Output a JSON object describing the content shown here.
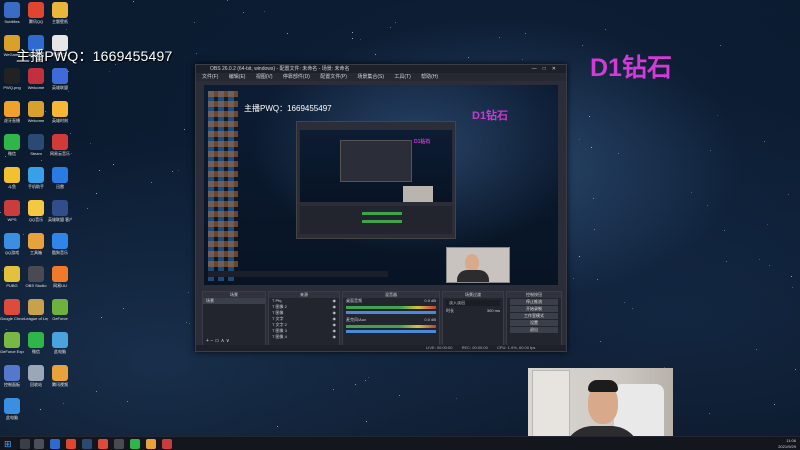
{
  "overlay": {
    "qq_text": "主播PWQ：1669455497",
    "rank_text": "D1钻石"
  },
  "desktop_icons": [
    {
      "label": "Subtitles",
      "color": "#3b6cc4"
    },
    {
      "label": "腾讯QQ",
      "color": "#e0452f"
    },
    {
      "label": "主题壁纸",
      "color": "#e9b63a"
    },
    {
      "label": "WeGame",
      "color": "#d9a02c"
    },
    {
      "label": "英雄联盟",
      "color": "#2d6bd1"
    },
    {
      "label": "新建文本",
      "color": "#e6e6e6"
    },
    {
      "label": "PWQ.png",
      "color": "#222222"
    },
    {
      "label": "Welcome",
      "color": "#c0303d"
    },
    {
      "label": "英雄联盟",
      "color": "#3f6bd8"
    },
    {
      "label": "虎牙直播",
      "color": "#f0a12b"
    },
    {
      "label": "Welcome",
      "color": "#d8a12e"
    },
    {
      "label": "英雄时刻",
      "color": "#f6b734"
    },
    {
      "label": "微信",
      "color": "#2fb64b"
    },
    {
      "label": "Steam",
      "color": "#2b4a73"
    },
    {
      "label": "网易云音乐",
      "color": "#d23a3a"
    },
    {
      "label": "斗鱼",
      "color": "#f2c12f"
    },
    {
      "label": "手机助手",
      "color": "#37a0e6"
    },
    {
      "label": "迅雷",
      "color": "#2b7be5"
    },
    {
      "label": "WPS",
      "color": "#c93d3d"
    },
    {
      "label": "QQ音乐",
      "color": "#f5c842"
    },
    {
      "label": "英雄联盟 客户端",
      "color": "#324e8a"
    },
    {
      "label": "QQ游戏",
      "color": "#3a8fe0"
    },
    {
      "label": "工具箱",
      "color": "#e8a23c"
    },
    {
      "label": "酷狗音乐",
      "color": "#2f86e8"
    },
    {
      "label": "PUBG",
      "color": "#e2c23d"
    },
    {
      "label": "OBS Studio",
      "color": "#4a4a52"
    },
    {
      "label": "网易UU",
      "color": "#f07a2a"
    },
    {
      "label": "Google Chrome",
      "color": "#dd4b3a"
    },
    {
      "label": "League of Legends",
      "color": "#c7a24a"
    },
    {
      "label": "GeForce",
      "color": "#6fb13d"
    },
    {
      "label": "GeForce Experience",
      "color": "#78b843"
    },
    {
      "label": "微信",
      "color": "#2fb64b"
    },
    {
      "label": "此电脑",
      "color": "#4aa3df"
    },
    {
      "label": "控制面板",
      "color": "#5577cc"
    },
    {
      "label": "回收站",
      "color": "#9aa7b7"
    },
    {
      "label": "腾讯视频",
      "color": "#e8a23c"
    },
    {
      "label": "此电脑",
      "color": "#3a8fe0"
    }
  ],
  "obs": {
    "title": "OBS 26.0.2 (64-bit, windows) - 配置文件: 未命名 - 场景: 未命名",
    "menu": [
      "文件(F)",
      "编辑(E)",
      "视图(V)",
      "停靠部件(D)",
      "配置文件(P)",
      "场景集合(S)",
      "工具(T)",
      "帮助(H)"
    ],
    "panels": {
      "scenes_header": "场景",
      "scenes_item": "场景",
      "sources_header": "来源",
      "sources": [
        "Pfq",
        "图像 2",
        "图像",
        "文字",
        "文字 2",
        "图像 3",
        "图像 4"
      ],
      "mixer_header": "混音器",
      "mixer_ch1": "桌面音频",
      "mixer_ch2": "麦克风/Aux",
      "mixer_db1": "0.0 dB",
      "mixer_db2": "0.0 dB",
      "transitions_header": "场景过渡",
      "transition_type": "淡入淡出",
      "transition_duration": "时长",
      "transition_ms": "300 ms",
      "controls_header": "控制按钮",
      "controls": [
        "停止推流",
        "开始录制",
        "工作室模式",
        "设置",
        "退出"
      ]
    },
    "status": {
      "live": "LIVE: 00:00:00",
      "rec": "REC: 00:00:00",
      "cpu": "CPU: 1.9%, 60.00 fps"
    }
  },
  "taskbar": {
    "time": "11:06",
    "date": "2021/9/29"
  }
}
